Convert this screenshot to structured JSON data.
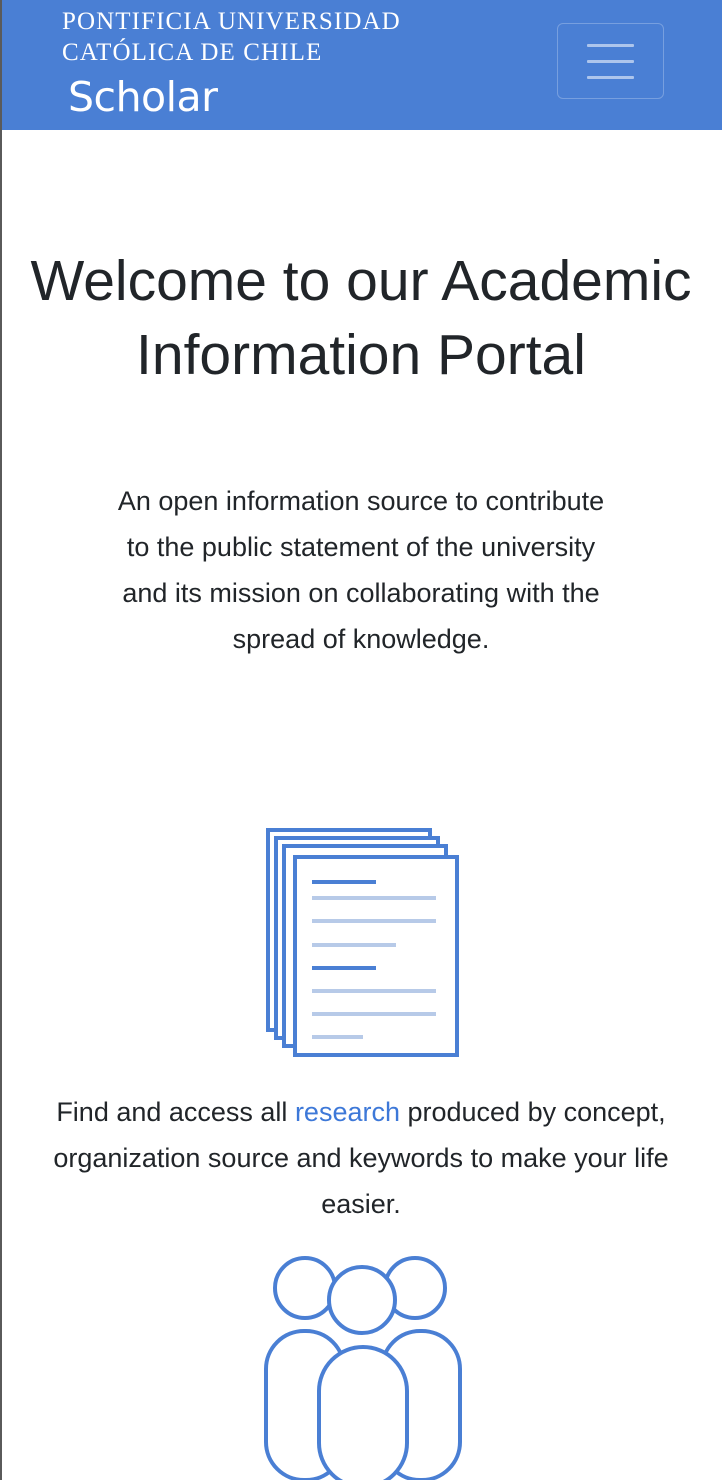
{
  "navbar": {
    "brand_line1": "PONTIFICIA UNIVERSIDAD",
    "brand_line2": "CATÓLICA DE CHILE",
    "brand_name": "Scholar",
    "menu_icon": "hamburger-menu-icon",
    "background_color": "#4a7fd4"
  },
  "hero": {
    "title": "Welcome to our Academic Information Portal",
    "subtitle": "An open information source to contribute to the public statement of the university and its mission on collaborating with the spread of knowledge."
  },
  "research_section": {
    "icon": "documents-icon",
    "text_before": "Find and access all ",
    "link_text": "research",
    "text_after": " produced by concept, organization source and keywords to make your life easier."
  },
  "people_section": {
    "icon": "people-group-icon"
  },
  "colors": {
    "accent": "#4a7fd4",
    "link": "#3d78d8",
    "text": "#212529"
  }
}
